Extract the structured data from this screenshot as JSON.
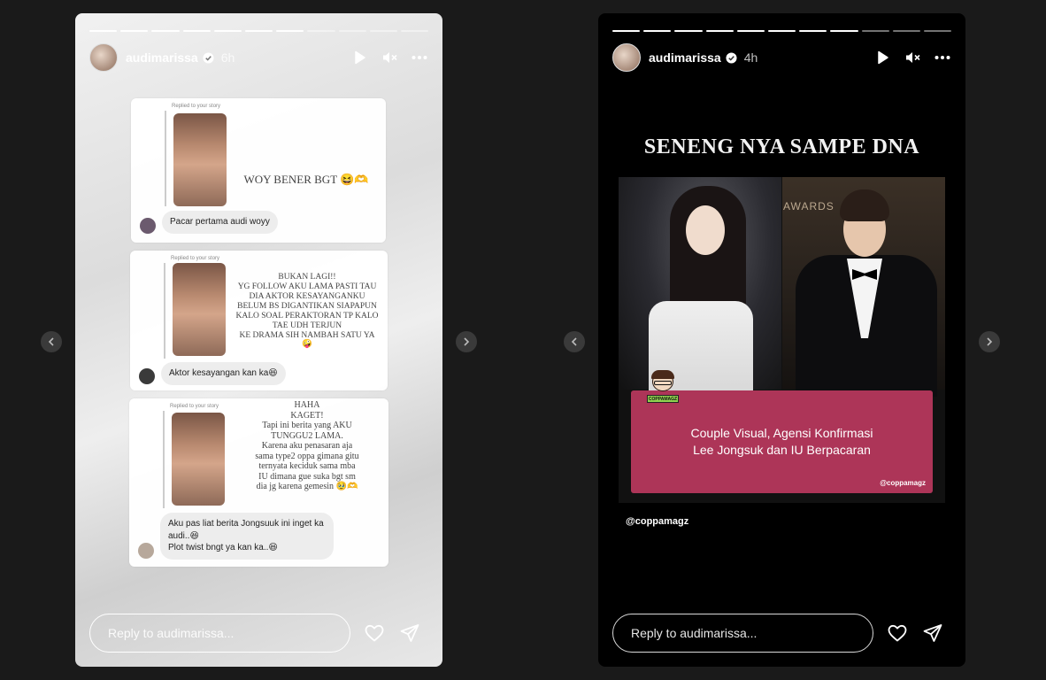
{
  "stories": [
    {
      "username": "audimarissa",
      "time": "6h",
      "progress": {
        "total": 11,
        "done": 7
      },
      "reply_placeholder": "Reply to audimarissa...",
      "cards": [
        {
          "replied_label": "Replied to your story",
          "overlay_text": "WOY BENER BGT 😆🫶",
          "comments": [
            "Pacar pertama audi woyy"
          ]
        },
        {
          "replied_label": "Replied to your story",
          "overlay_text": "BUKAN LAGI!!\nYG FOLLOW AKU LAMA PASTI TAU\nDIA AKTOR KESAYANGANKU\nBELUM BS DIGANTIKAN SIAPAPUN\nKALO SOAL PERAKTORAN TP KALO\nTAE UDH TERJUN\nKE DRAMA SIH NAMBAH SATU YA\n🤪",
          "comments": [
            "Aktor kesayangan kan ka😆"
          ]
        },
        {
          "replied_label": "Replied to your story",
          "overlay_text": "HAHA\nKAGET!\nTapi ini berita yang AKU\nTUNGGU2 LAMA.\nKarena aku penasaran aja\nsama type2 oppa gimana gitu\nternyata keciduk sama mba\nIU dimana gue suka bgt sm\ndia jg karena gemesin 🥹🫶",
          "comments": [
            "Aku pas liat  berita Jongsuuk ini inget ka audi..😆",
            "Plot twist bngt ya kan ka..😆"
          ]
        }
      ]
    },
    {
      "username": "audimarissa",
      "time": "4h",
      "progress": {
        "total": 11,
        "done": 8
      },
      "reply_placeholder": "Reply to audimarissa...",
      "headline": "SENENG NYA SAMPE DNA",
      "awards_text": "AWARDS",
      "mascot_label": "COPPAMAGZ",
      "banner_text": "Couple Visual, Agensi Konfirmasi\nLee Jongsuk dan IU Berpacaran",
      "banner_credit": "@coppamagz",
      "credit": "@coppamagz"
    }
  ],
  "icons": {
    "play": "play-icon",
    "mute": "speaker-muted-icon",
    "more": "more-horizontal-icon",
    "like": "heart-icon",
    "share": "paper-plane-icon",
    "prev": "chevron-left-icon",
    "next": "chevron-right-icon",
    "verified": "verified-badge-icon"
  },
  "colors": {
    "background": "#1a1a1a",
    "banner": "#ad3558",
    "verified": "#3897f0"
  }
}
